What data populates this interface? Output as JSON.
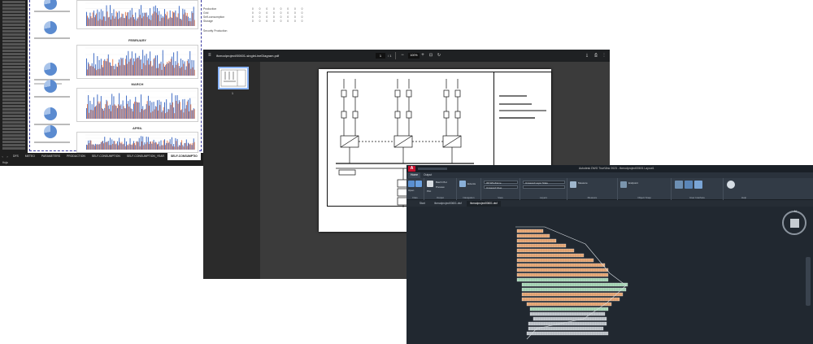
{
  "excel": {
    "sheet_tabs": [
      "DFS",
      "METEO",
      "PARAMETERS",
      "PRODUCTION",
      "SELF-CONSUMPTION",
      "SELF-CONSUMPTION_YEAR",
      "SELF-CONSUMPTIO"
    ],
    "months": [
      "FEBRUARY",
      "MARCH",
      "APRIL"
    ],
    "status_text": "Hoja",
    "summary_rows": [
      "Production",
      "Grid",
      "Self-consumption",
      "Storage"
    ],
    "summary_values": [
      "0",
      "0",
      "0",
      "0",
      "0",
      "0",
      "0",
      "0"
    ],
    "selected_row_label": "Security Production",
    "colors": {
      "series_blue": "#2f5fbf",
      "series_orange": "#e8794a",
      "pie_main": "#5b8bd0"
    }
  },
  "pdf": {
    "file_name": "ifcmodproject/00601-singleLineDiagram.pdf",
    "page_current": "1",
    "page_total": "/ 1",
    "zoom": "100%",
    "thumb_number": "1",
    "menu_icon": "hamburger-icon",
    "toolbar_icons": [
      "zoom-out-icon",
      "zoom-in-icon",
      "fit-page-icon",
      "rotate-icon",
      "download-icon",
      "print-icon",
      "more-icon"
    ]
  },
  "cad": {
    "app_logo": "A",
    "window_title": "Autodesk DWG TrueView 2023 - ifcmodproject00601 Layout1",
    "ribbon_tabs": [
      "Home",
      "Output"
    ],
    "ribbon_groups": [
      "Files",
      "Output",
      "Navigation",
      "View",
      "Layers",
      "Measure",
      "Object Snap",
      "User Interface",
      "Help"
    ],
    "ribbon_labels": {
      "open": "Open",
      "import": "Batch Plot",
      "preview": "Preview",
      "plot": "Plot",
      "extents": "Extents",
      "layer_combo": "3D Wireframe",
      "viewport_combo": "Unsaved View",
      "layer_state": "Unsaved Layer State",
      "measure": "Measure",
      "object_snap": "Endpoint",
      "user_interface": "User Interface",
      "help": "Help"
    },
    "doc_tabs": [
      "Start",
      "ifcmodproject00601.dwf",
      "ifcmodproject00601.dwf"
    ],
    "compass_n": "N"
  }
}
